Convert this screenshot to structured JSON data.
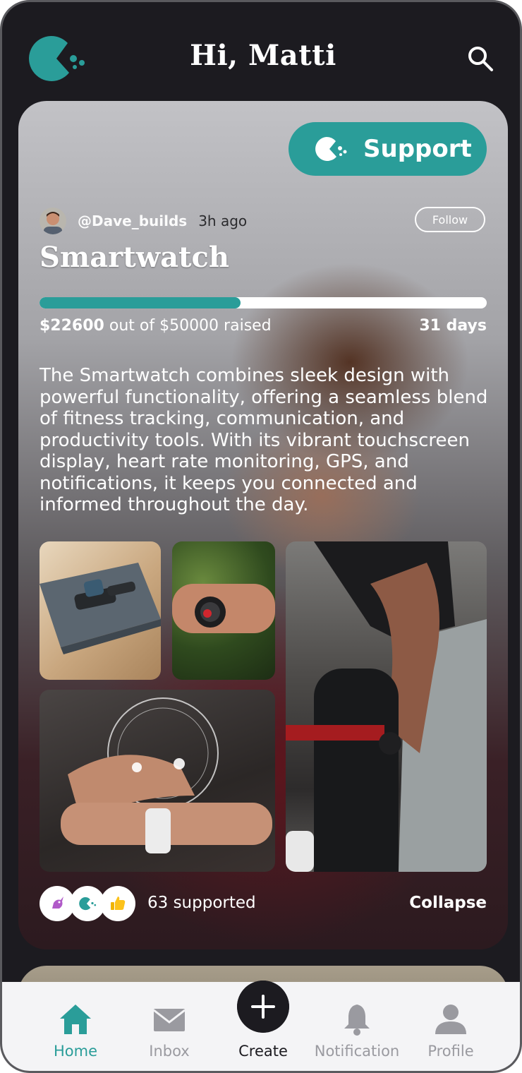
{
  "header": {
    "greeting": "Hi, Matti",
    "logo_icon": "pacman-logo-icon",
    "search_icon": "search-icon"
  },
  "colors": {
    "accent": "#2a9d99",
    "background": "#1c1b20",
    "nav_background": "#f4f4f6",
    "nav_inactive": "#9a9aa0"
  },
  "post": {
    "support_label": "Support",
    "author_handle": "@Dave_builds",
    "time_ago": "3h ago",
    "follow_label": "Follow",
    "title": "Smartwatch",
    "raised_amount": "$22600",
    "raised_rest": " out of $50000 raised",
    "progress_fraction": 0.45,
    "days_left": "31 days",
    "description": "The Smartwatch combines sleek design with powerful functionality, offering a seamless blend of fitness tracking, communication, and productivity tools. With its vibrant touchscreen display, heart rate monitoring, GPS, and notifications, it keeps you connected and informed throughout the day.",
    "supported_text": "63 supported",
    "collapse_label": "Collapse",
    "supporter_icons": [
      "unicorn-icon",
      "pacman-logo-icon",
      "thumbs-up-icon"
    ]
  },
  "nav": {
    "items": [
      {
        "label": "Home",
        "icon": "home-icon",
        "active": true
      },
      {
        "label": "Inbox",
        "icon": "mail-icon",
        "active": false
      },
      {
        "label": "Create",
        "icon": "plus-icon",
        "active": false
      },
      {
        "label": "Notification",
        "icon": "bell-icon",
        "active": false
      },
      {
        "label": "Profile",
        "icon": "user-icon",
        "active": false
      }
    ]
  }
}
